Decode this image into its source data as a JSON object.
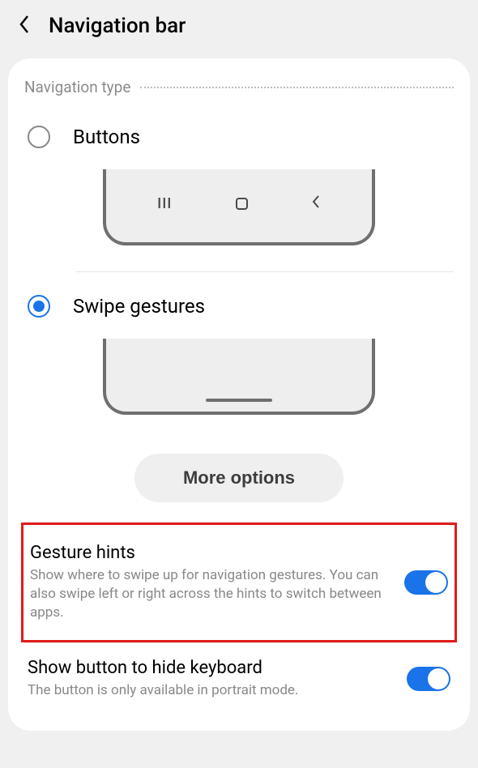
{
  "header": {
    "title": "Navigation bar"
  },
  "section": {
    "label": "Navigation type"
  },
  "options": {
    "buttons": {
      "label": "Buttons",
      "selected": false
    },
    "gestures": {
      "label": "Swipe gestures",
      "selected": true
    }
  },
  "moreBtn": {
    "label": "More options"
  },
  "settings": {
    "gestureHints": {
      "title": "Gesture hints",
      "desc": "Show where to swipe up for navigation gestures. You can also swipe left or right across the hints to switch between apps.",
      "on": true
    },
    "hideKeyboard": {
      "title": "Show button to hide keyboard",
      "desc": "The button is only available in portrait mode.",
      "on": true
    }
  }
}
